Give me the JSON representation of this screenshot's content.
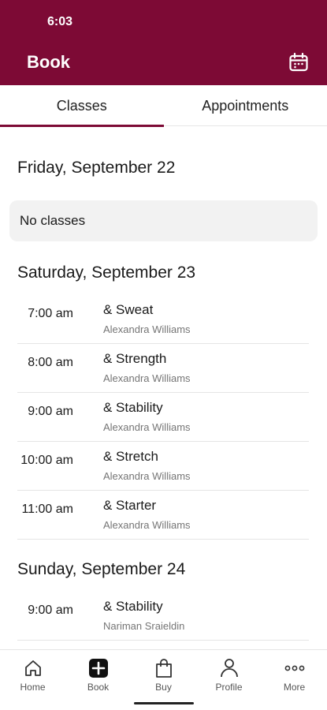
{
  "status_bar": {
    "time": "6:03"
  },
  "header": {
    "title": "Book",
    "calendar_icon": "calendar-icon"
  },
  "tabs": [
    {
      "label": "Classes",
      "active": true
    },
    {
      "label": "Appointments",
      "active": false
    }
  ],
  "days": [
    {
      "heading": "Friday, September 22",
      "empty_text": "No classes"
    },
    {
      "heading": "Saturday, September 23",
      "classes": [
        {
          "time": "7:00 am",
          "name": "& Sweat",
          "instructor": "Alexandra Williams"
        },
        {
          "time": "8:00 am",
          "name": "& Strength",
          "instructor": "Alexandra Williams"
        },
        {
          "time": "9:00 am",
          "name": "& Stability",
          "instructor": "Alexandra Williams"
        },
        {
          "time": "10:00 am",
          "name": "& Stretch",
          "instructor": "Alexandra Williams"
        },
        {
          "time": "11:00 am",
          "name": "& Starter",
          "instructor": "Alexandra Williams"
        }
      ]
    },
    {
      "heading": "Sunday, September 24",
      "classes": [
        {
          "time": "9:00 am",
          "name": "& Stability",
          "instructor": "Nariman Sraieldin"
        }
      ]
    }
  ],
  "bottom_nav": [
    {
      "label": "Home",
      "icon": "home-icon"
    },
    {
      "label": "Book",
      "icon": "plus-square-icon"
    },
    {
      "label": "Buy",
      "icon": "shopping-bag-icon"
    },
    {
      "label": "Profile",
      "icon": "person-icon"
    },
    {
      "label": "More",
      "icon": "more-dots-icon"
    }
  ],
  "colors": {
    "brand": "#7d0a35",
    "empty_bg": "#f2f2f2",
    "muted_text": "#757575"
  }
}
